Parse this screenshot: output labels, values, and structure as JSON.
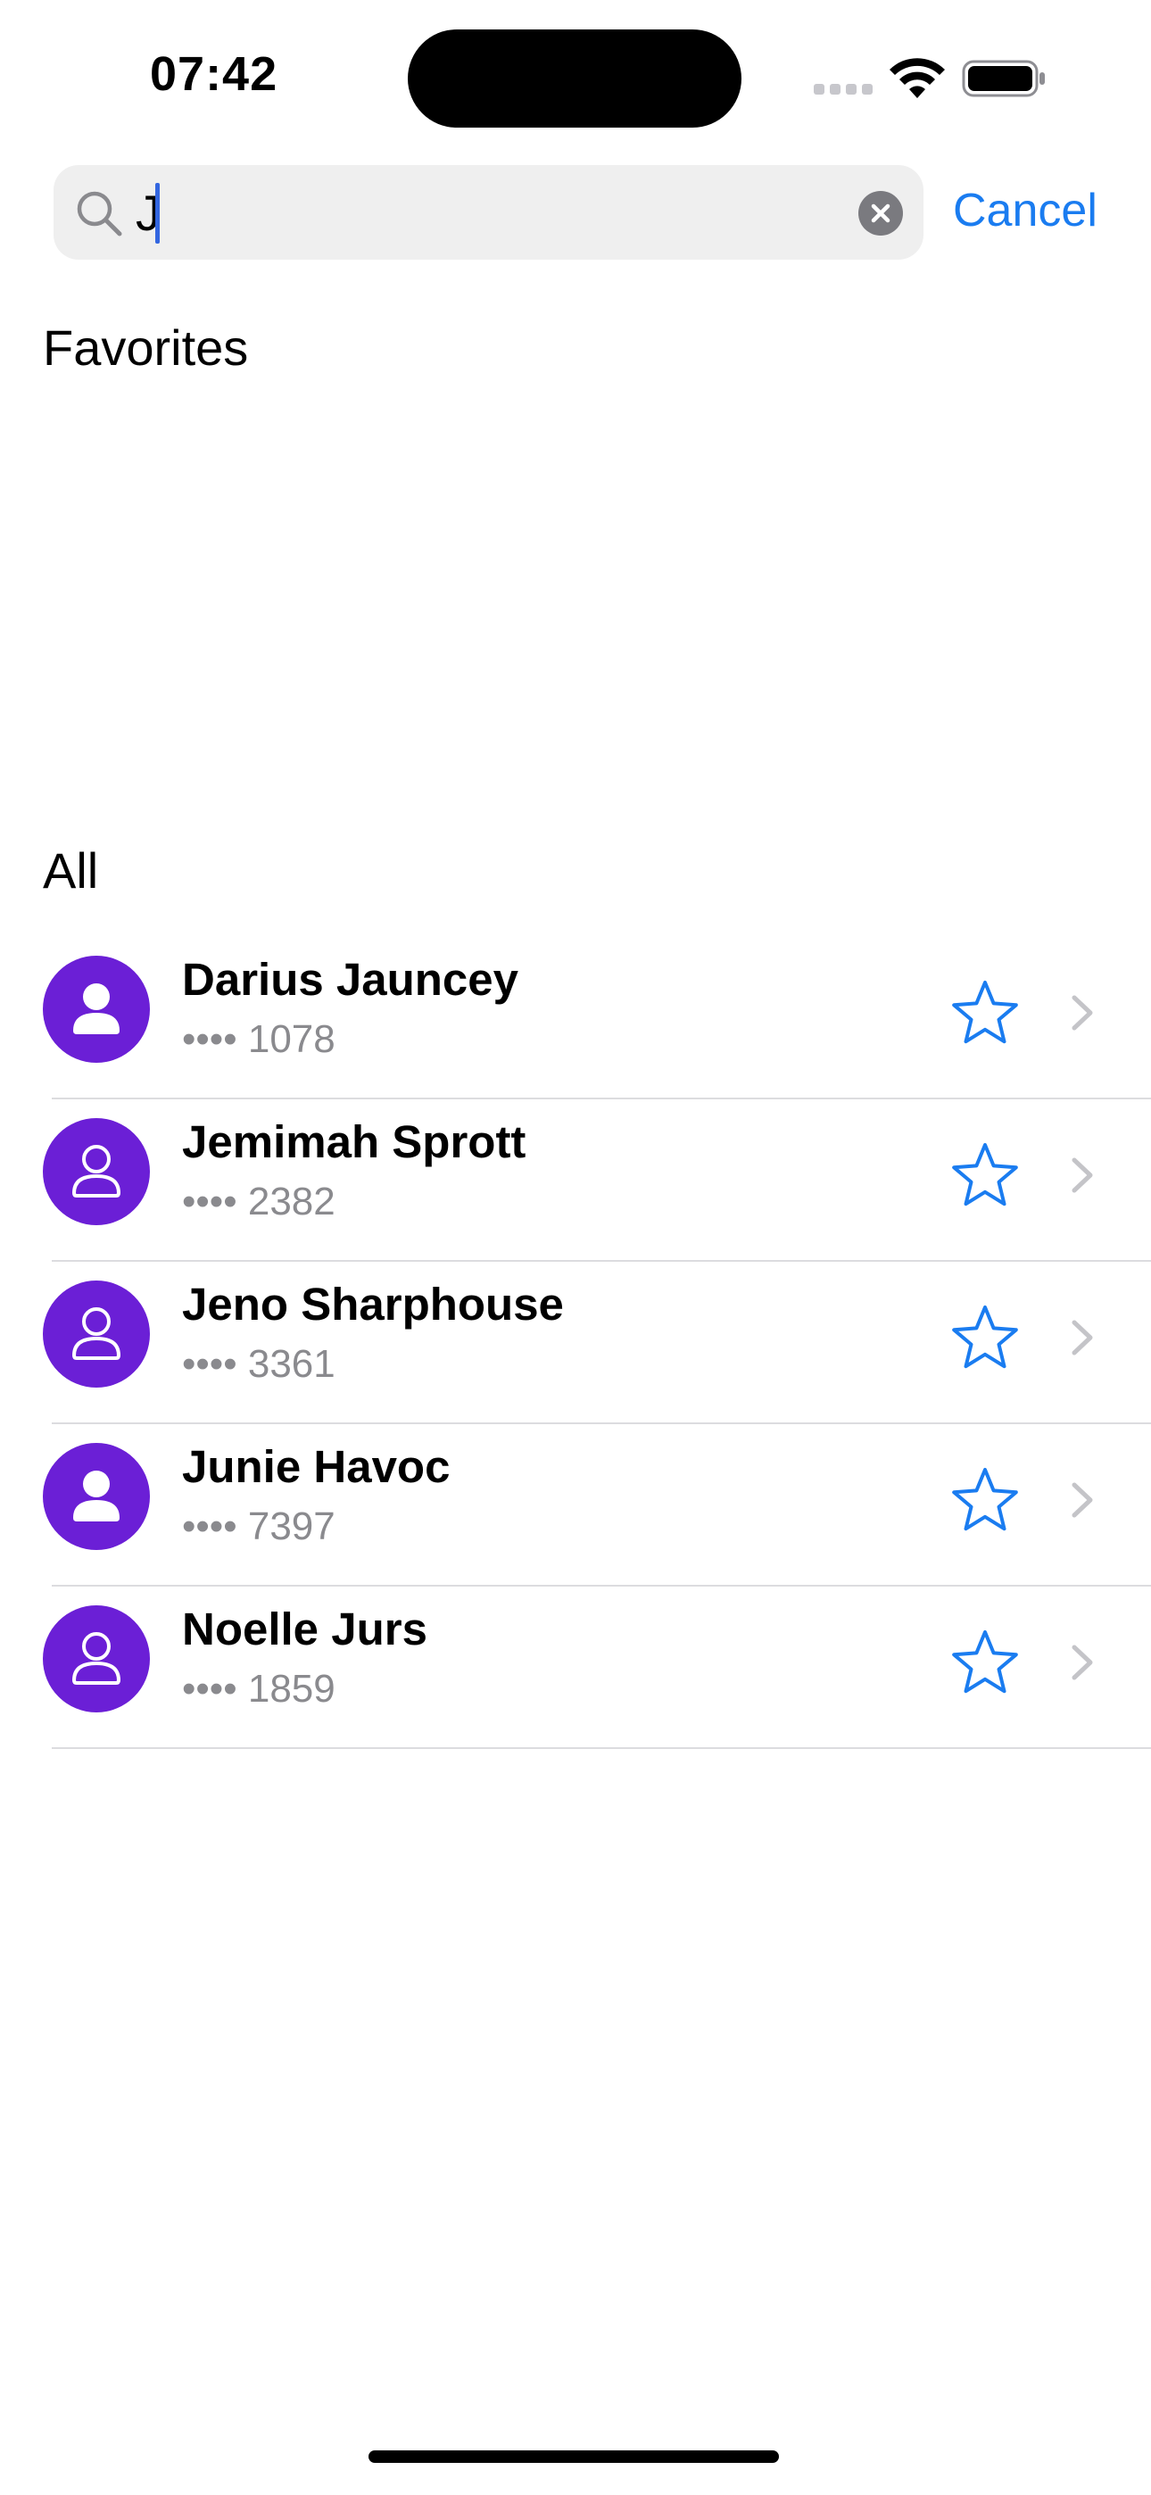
{
  "status_bar": {
    "time": "07:42"
  },
  "search": {
    "value": "J",
    "cancel_label": "Cancel"
  },
  "sections": {
    "favorites": "Favorites",
    "all": "All"
  },
  "contacts": [
    {
      "name": "Darius Jauncey",
      "number": "•••• 1078",
      "avatar_style": "filled",
      "favorite": false
    },
    {
      "name": "Jemimah Sprott",
      "number": "•••• 2382",
      "avatar_style": "outline",
      "favorite": false
    },
    {
      "name": "Jeno Sharphouse",
      "number": "•••• 3361",
      "avatar_style": "outline",
      "favorite": false
    },
    {
      "name": "Junie Havoc",
      "number": "•••• 7397",
      "avatar_style": "filled",
      "favorite": false
    },
    {
      "name": "Noelle Jurs",
      "number": "•••• 1859",
      "avatar_style": "outline",
      "favorite": false
    }
  ],
  "colors": {
    "accent": "#1a7cf0",
    "avatar": "#6b1fd6",
    "secondary_text": "#8a8a8e"
  },
  "icons": {
    "search": "magnifying-glass",
    "clear": "xmark-circle-fill",
    "favorite": "star-outline",
    "disclosure": "chevron-right"
  }
}
